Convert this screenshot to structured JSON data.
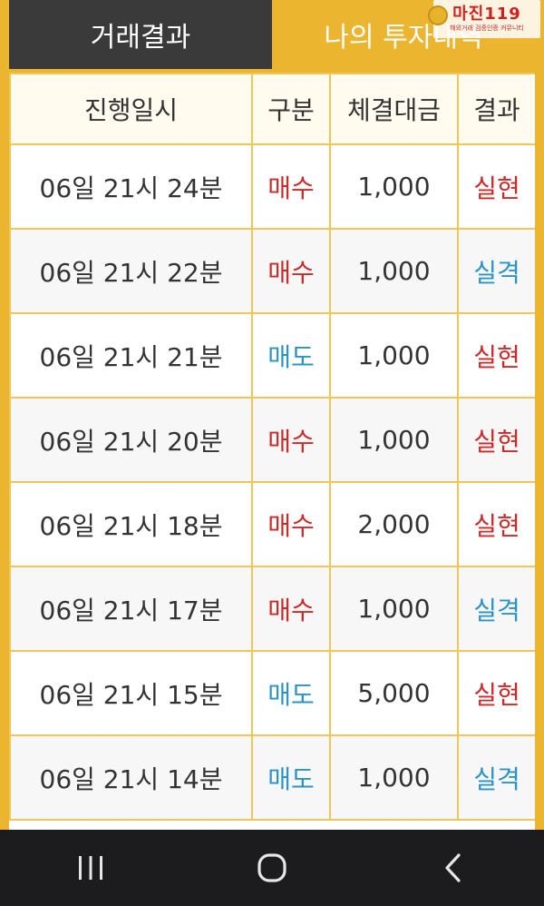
{
  "tabs": {
    "left_label": "거래결과",
    "right_label": "나의 투자내역"
  },
  "logo": {
    "main": "마진119",
    "sub": "해외거래 검증인증 커뮤니티"
  },
  "table": {
    "headers": [
      "진행일시",
      "구분",
      "체결대금",
      "결과"
    ],
    "rows": [
      {
        "datetime": "06일 21시 24분",
        "type": "매수",
        "amount": "1,000",
        "result": "실현"
      },
      {
        "datetime": "06일 21시 22분",
        "type": "매수",
        "amount": "1,000",
        "result": "실격"
      },
      {
        "datetime": "06일 21시 21분",
        "type": "매도",
        "amount": "1,000",
        "result": "실현"
      },
      {
        "datetime": "06일 21시 20분",
        "type": "매수",
        "amount": "1,000",
        "result": "실현"
      },
      {
        "datetime": "06일 21시 18분",
        "type": "매수",
        "amount": "2,000",
        "result": "실현"
      },
      {
        "datetime": "06일 21시 17분",
        "type": "매수",
        "amount": "1,000",
        "result": "실격"
      },
      {
        "datetime": "06일 21시 15분",
        "type": "매도",
        "amount": "5,000",
        "result": "실현"
      },
      {
        "datetime": "06일 21시 14분",
        "type": "매도",
        "amount": "1,000",
        "result": "실격"
      }
    ]
  },
  "navbar": {
    "icons": [
      "recent-apps-icon",
      "home-icon",
      "back-icon"
    ]
  },
  "colors": {
    "accent": "#ebb52f",
    "dark_tab": "#3a3a3a",
    "buy": "#cc2929",
    "sell": "#2c93c6",
    "realized": "#cc2929",
    "failed": "#2c93c6"
  }
}
